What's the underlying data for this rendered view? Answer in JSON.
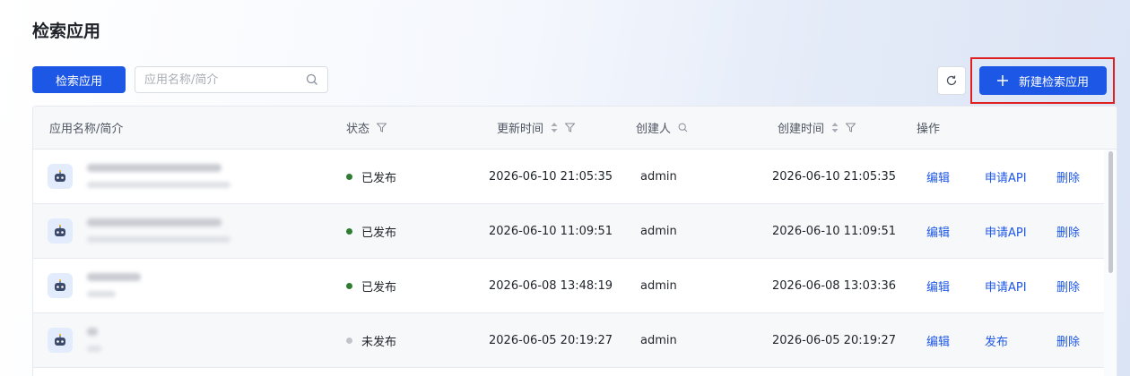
{
  "page": {
    "title": "检索应用"
  },
  "toolbar": {
    "tab_button": "检索应用",
    "search_placeholder": "应用名称/简介",
    "new_button": "新建检索应用",
    "accent": "#1d57e6"
  },
  "table": {
    "headers": {
      "name": "应用名称/简介",
      "status": "状态",
      "updated": "更新时间",
      "creator": "创建人",
      "created": "创建时间",
      "actions": "操作"
    },
    "rows": [
      {
        "status": "已发布",
        "status_color": "#2e7d32",
        "updated": "2026-06-10 21:05:35",
        "creator": "admin",
        "created": "2026-06-10 21:05:35",
        "action1": "编辑",
        "action2": "申请API",
        "action3": "删除"
      },
      {
        "status": "已发布",
        "status_color": "#2e7d32",
        "updated": "2026-06-10 11:09:51",
        "creator": "admin",
        "created": "2026-06-10 11:09:51",
        "action1": "编辑",
        "action2": "申请API",
        "action3": "删除"
      },
      {
        "status": "已发布",
        "status_color": "#2e7d32",
        "updated": "2026-06-08 13:48:19",
        "creator": "admin",
        "created": "2026-06-08 13:03:36",
        "action1": "编辑",
        "action2": "申请API",
        "action3": "删除"
      },
      {
        "status": "未发布",
        "status_color": "#c0c4cc",
        "updated": "2026-06-05 20:19:27",
        "creator": "admin",
        "created": "2026-06-05 20:19:27",
        "action1": "编辑",
        "action2": "发布",
        "action3": "删除"
      }
    ]
  }
}
